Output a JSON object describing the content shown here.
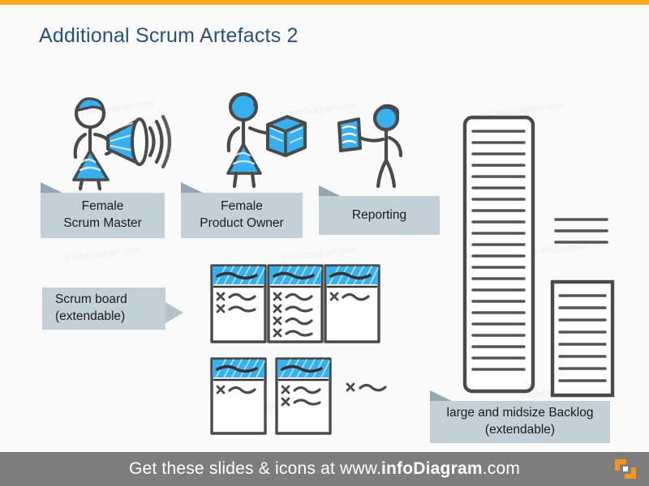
{
  "slide": {
    "title": "Additional Scrum Artefacts 2",
    "accent_top_bar_color": "#ffa91e",
    "background_color": "#fafafa",
    "title_color": "#28517f",
    "label_box_color": "#c3d0d8",
    "label_fold_color": "#93a8b4",
    "sketch_ink_color": "#4a4a4a",
    "sketch_accent_color": "#38b0ef"
  },
  "labels": {
    "scrum_master": {
      "line1": "Female",
      "line2": "Scrum Master"
    },
    "product_owner": {
      "line1": "Female",
      "line2": "Product Owner"
    },
    "reporting": {
      "line1": "Reporting"
    },
    "scrum_board": {
      "line1": "Scrum board",
      "line2": "(extendable)"
    },
    "backlog": {
      "line1": "large and midsize Backlog",
      "line2": "(extendable)"
    }
  },
  "icons": {
    "scrum_master": "female-scrum-master-megaphone-icon",
    "product_owner": "female-product-owner-box-icon",
    "reporting": "reporting-person-document-icon",
    "scrum_board": "scrum-board-columns-icon",
    "large_backlog": "large-backlog-list-icon",
    "midsize_backlog": "midsize-backlog-list-icon",
    "logo": "infodiagram-logo-icon"
  },
  "scrum_board": {
    "top_row_columns": [
      {
        "tasks": 2
      },
      {
        "tasks": 4
      },
      {
        "tasks": 1
      }
    ],
    "bottom_row_columns": [
      {
        "tasks": 1
      },
      {
        "tasks": 2
      }
    ],
    "loose_task_items": 1
  },
  "backlogs": {
    "large": {
      "line_items": 22
    },
    "midsize": {
      "line_items": 8,
      "detached_lines": 3
    }
  },
  "watermark": {
    "text": "© infoDiagram.com"
  },
  "footer": {
    "text_before": "Get these slides & icons at www.",
    "brand": "infoDiagram",
    "text_after": ".com"
  }
}
